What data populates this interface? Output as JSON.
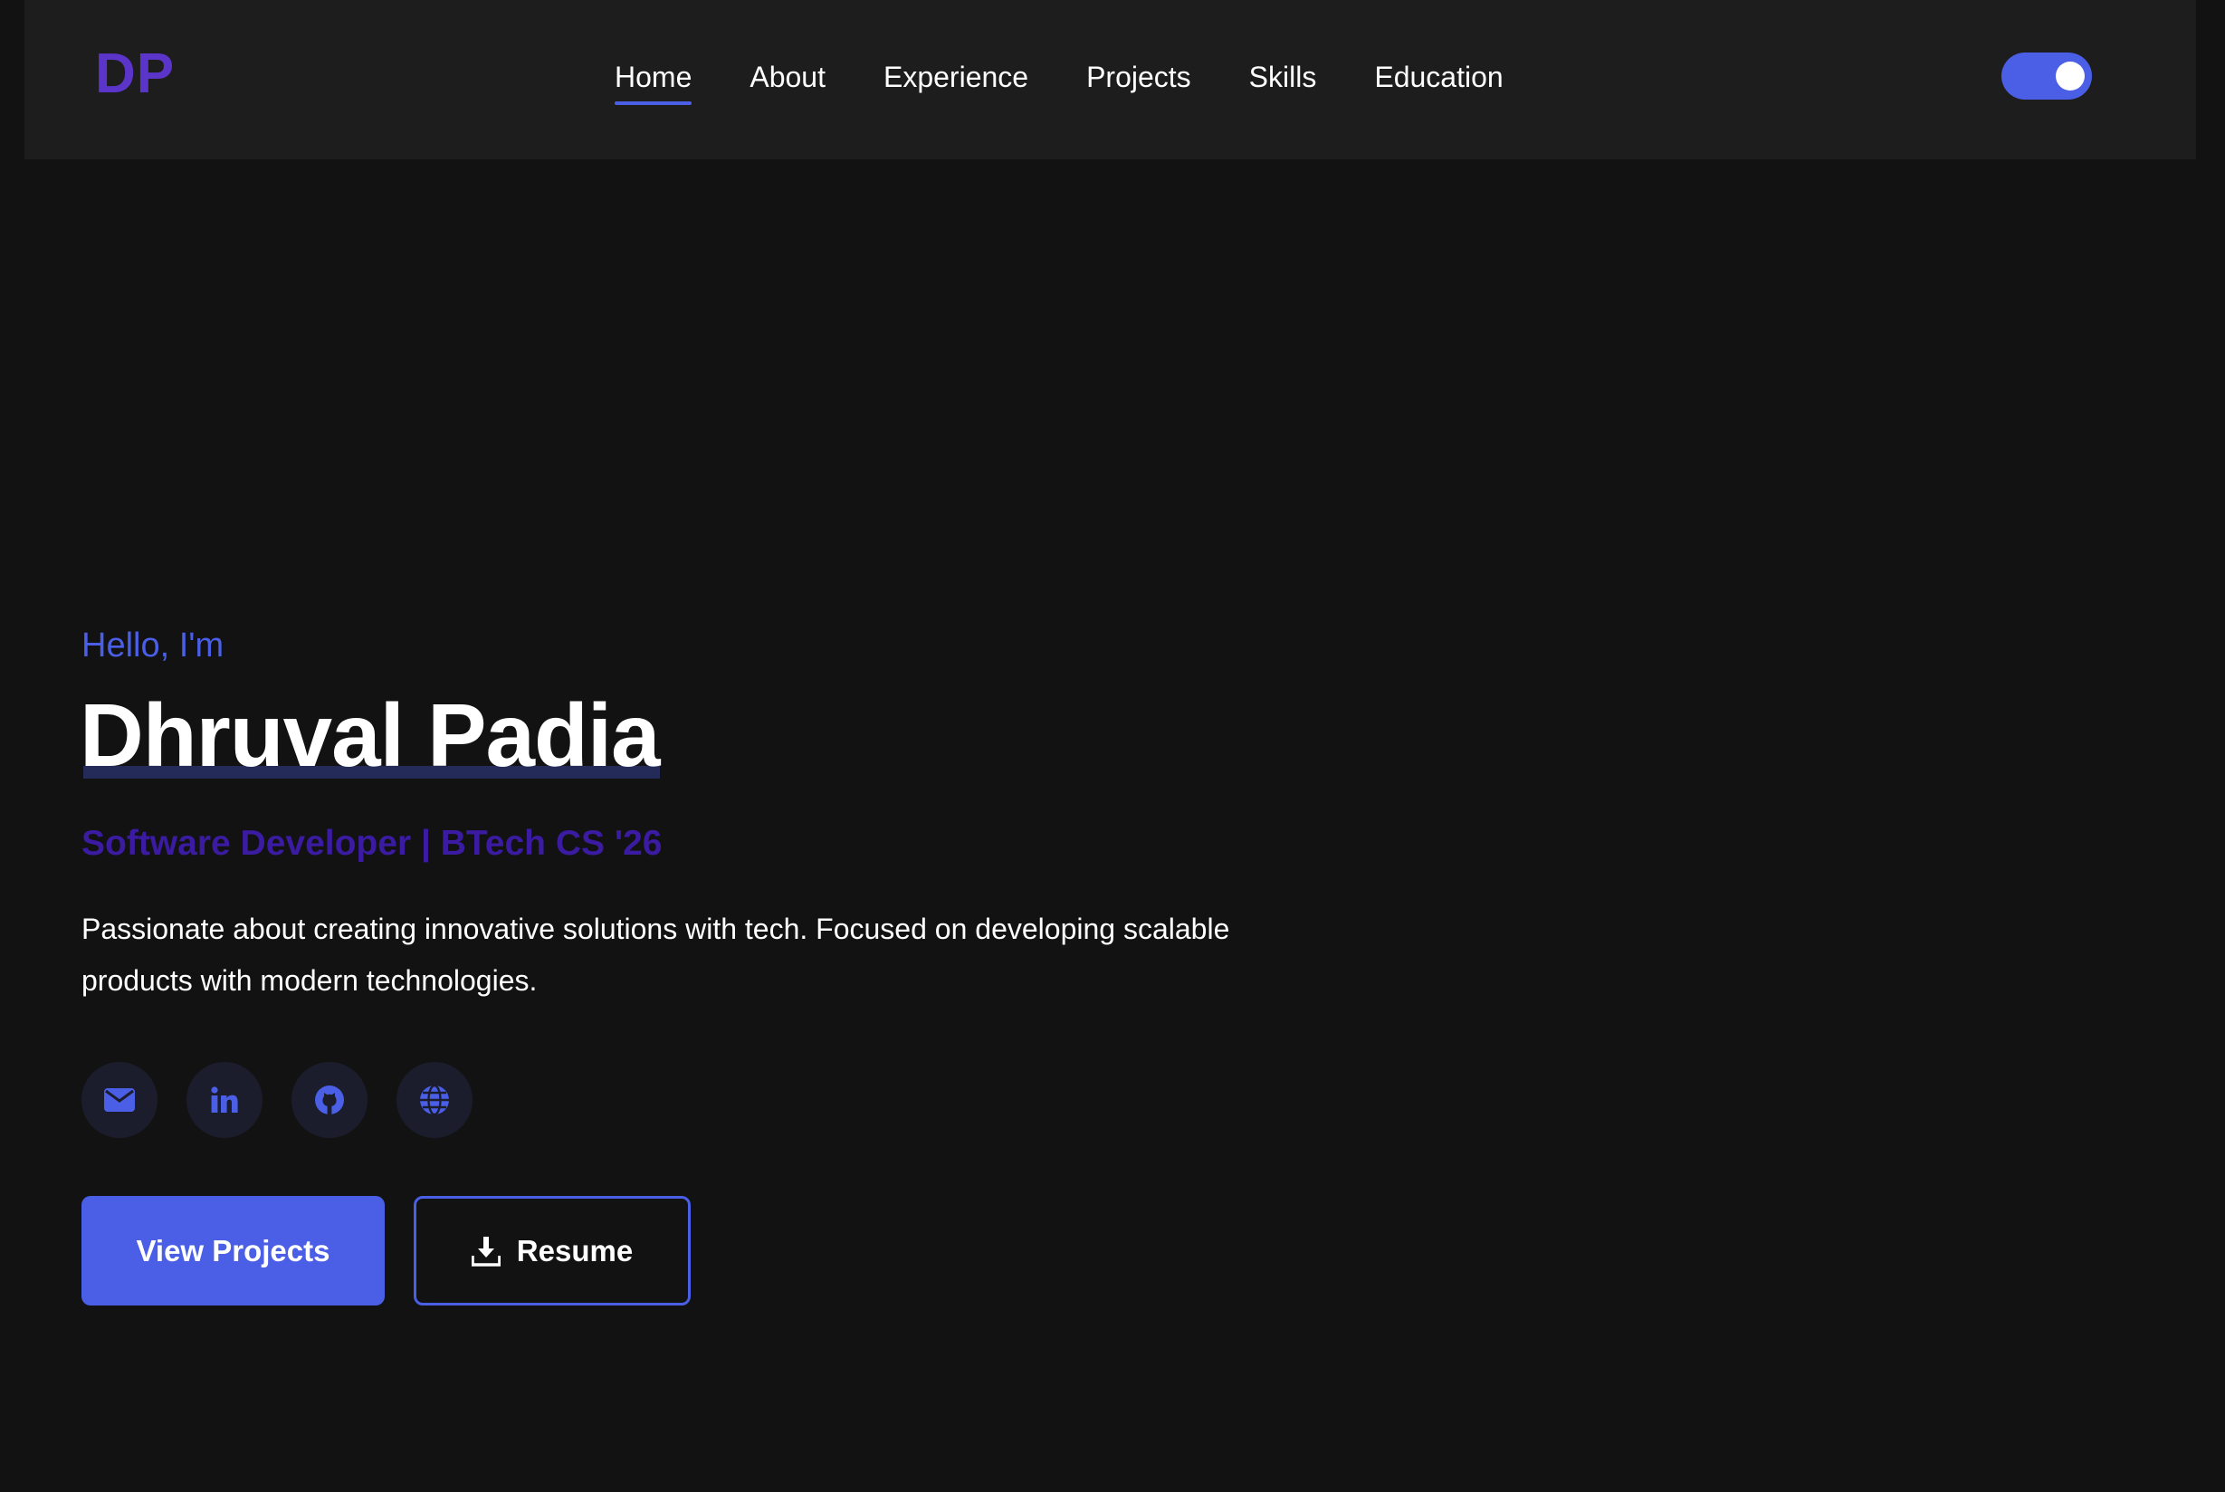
{
  "brand": {
    "logo_text": "DP"
  },
  "nav": {
    "items": [
      {
        "label": "Home",
        "active": true
      },
      {
        "label": "About"
      },
      {
        "label": "Experience"
      },
      {
        "label": "Projects"
      },
      {
        "label": "Skills"
      },
      {
        "label": "Education"
      }
    ],
    "theme_toggle": {
      "on": true,
      "icon": "toggle-switch"
    }
  },
  "hero": {
    "greeting": "Hello, I'm",
    "name": "Dhruval Padia",
    "role": "Software Developer | BTech CS '26",
    "bio": "Passionate about creating innovative solutions with tech. Focused on developing scalable products with modern technologies.",
    "socials": [
      {
        "icon": "email-icon"
      },
      {
        "icon": "linkedin-icon"
      },
      {
        "icon": "github-icon"
      },
      {
        "icon": "globe-icon"
      }
    ],
    "primary_button": "View Projects",
    "secondary_button": "Resume",
    "secondary_button_icon": "download-icon"
  },
  "colors": {
    "background": "#121212",
    "navbar": "#1d1d1d",
    "accent": "#4a5fe6",
    "logo": "#5b34c9",
    "role_text": "#3a1ba1"
  }
}
